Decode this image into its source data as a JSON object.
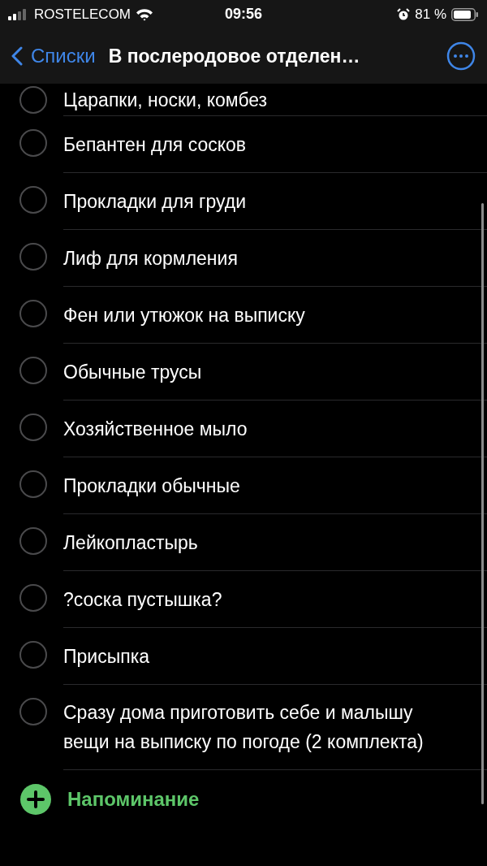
{
  "status_bar": {
    "carrier": "ROSTELECOM",
    "time": "09:56",
    "battery": "81 %"
  },
  "nav": {
    "back": "Списки",
    "title": "В послеродовое отделен…"
  },
  "items": [
    {
      "text": "Царапки, носки, комбез",
      "checked": false
    },
    {
      "text": "Бепантен для сосков",
      "checked": false
    },
    {
      "text": "Прокладки для груди",
      "checked": false
    },
    {
      "text": "Лиф для кормления",
      "checked": false
    },
    {
      "text": "Фен или утюжок на выписку",
      "checked": false
    },
    {
      "text": "Обычные трусы",
      "checked": false
    },
    {
      "text": "Хозяйственное мыло",
      "checked": false
    },
    {
      "text": "Прокладки обычные",
      "checked": false
    },
    {
      "text": "Лейкопластырь",
      "checked": false
    },
    {
      "text": "?соска пустышка?",
      "checked": false
    },
    {
      "text": "Присыпка",
      "checked": false
    },
    {
      "text": "Сразу дома приготовить себе и малышу вещи на выписку по погоде (2 комплекта)",
      "checked": false
    }
  ],
  "add_button": "Напоминание"
}
